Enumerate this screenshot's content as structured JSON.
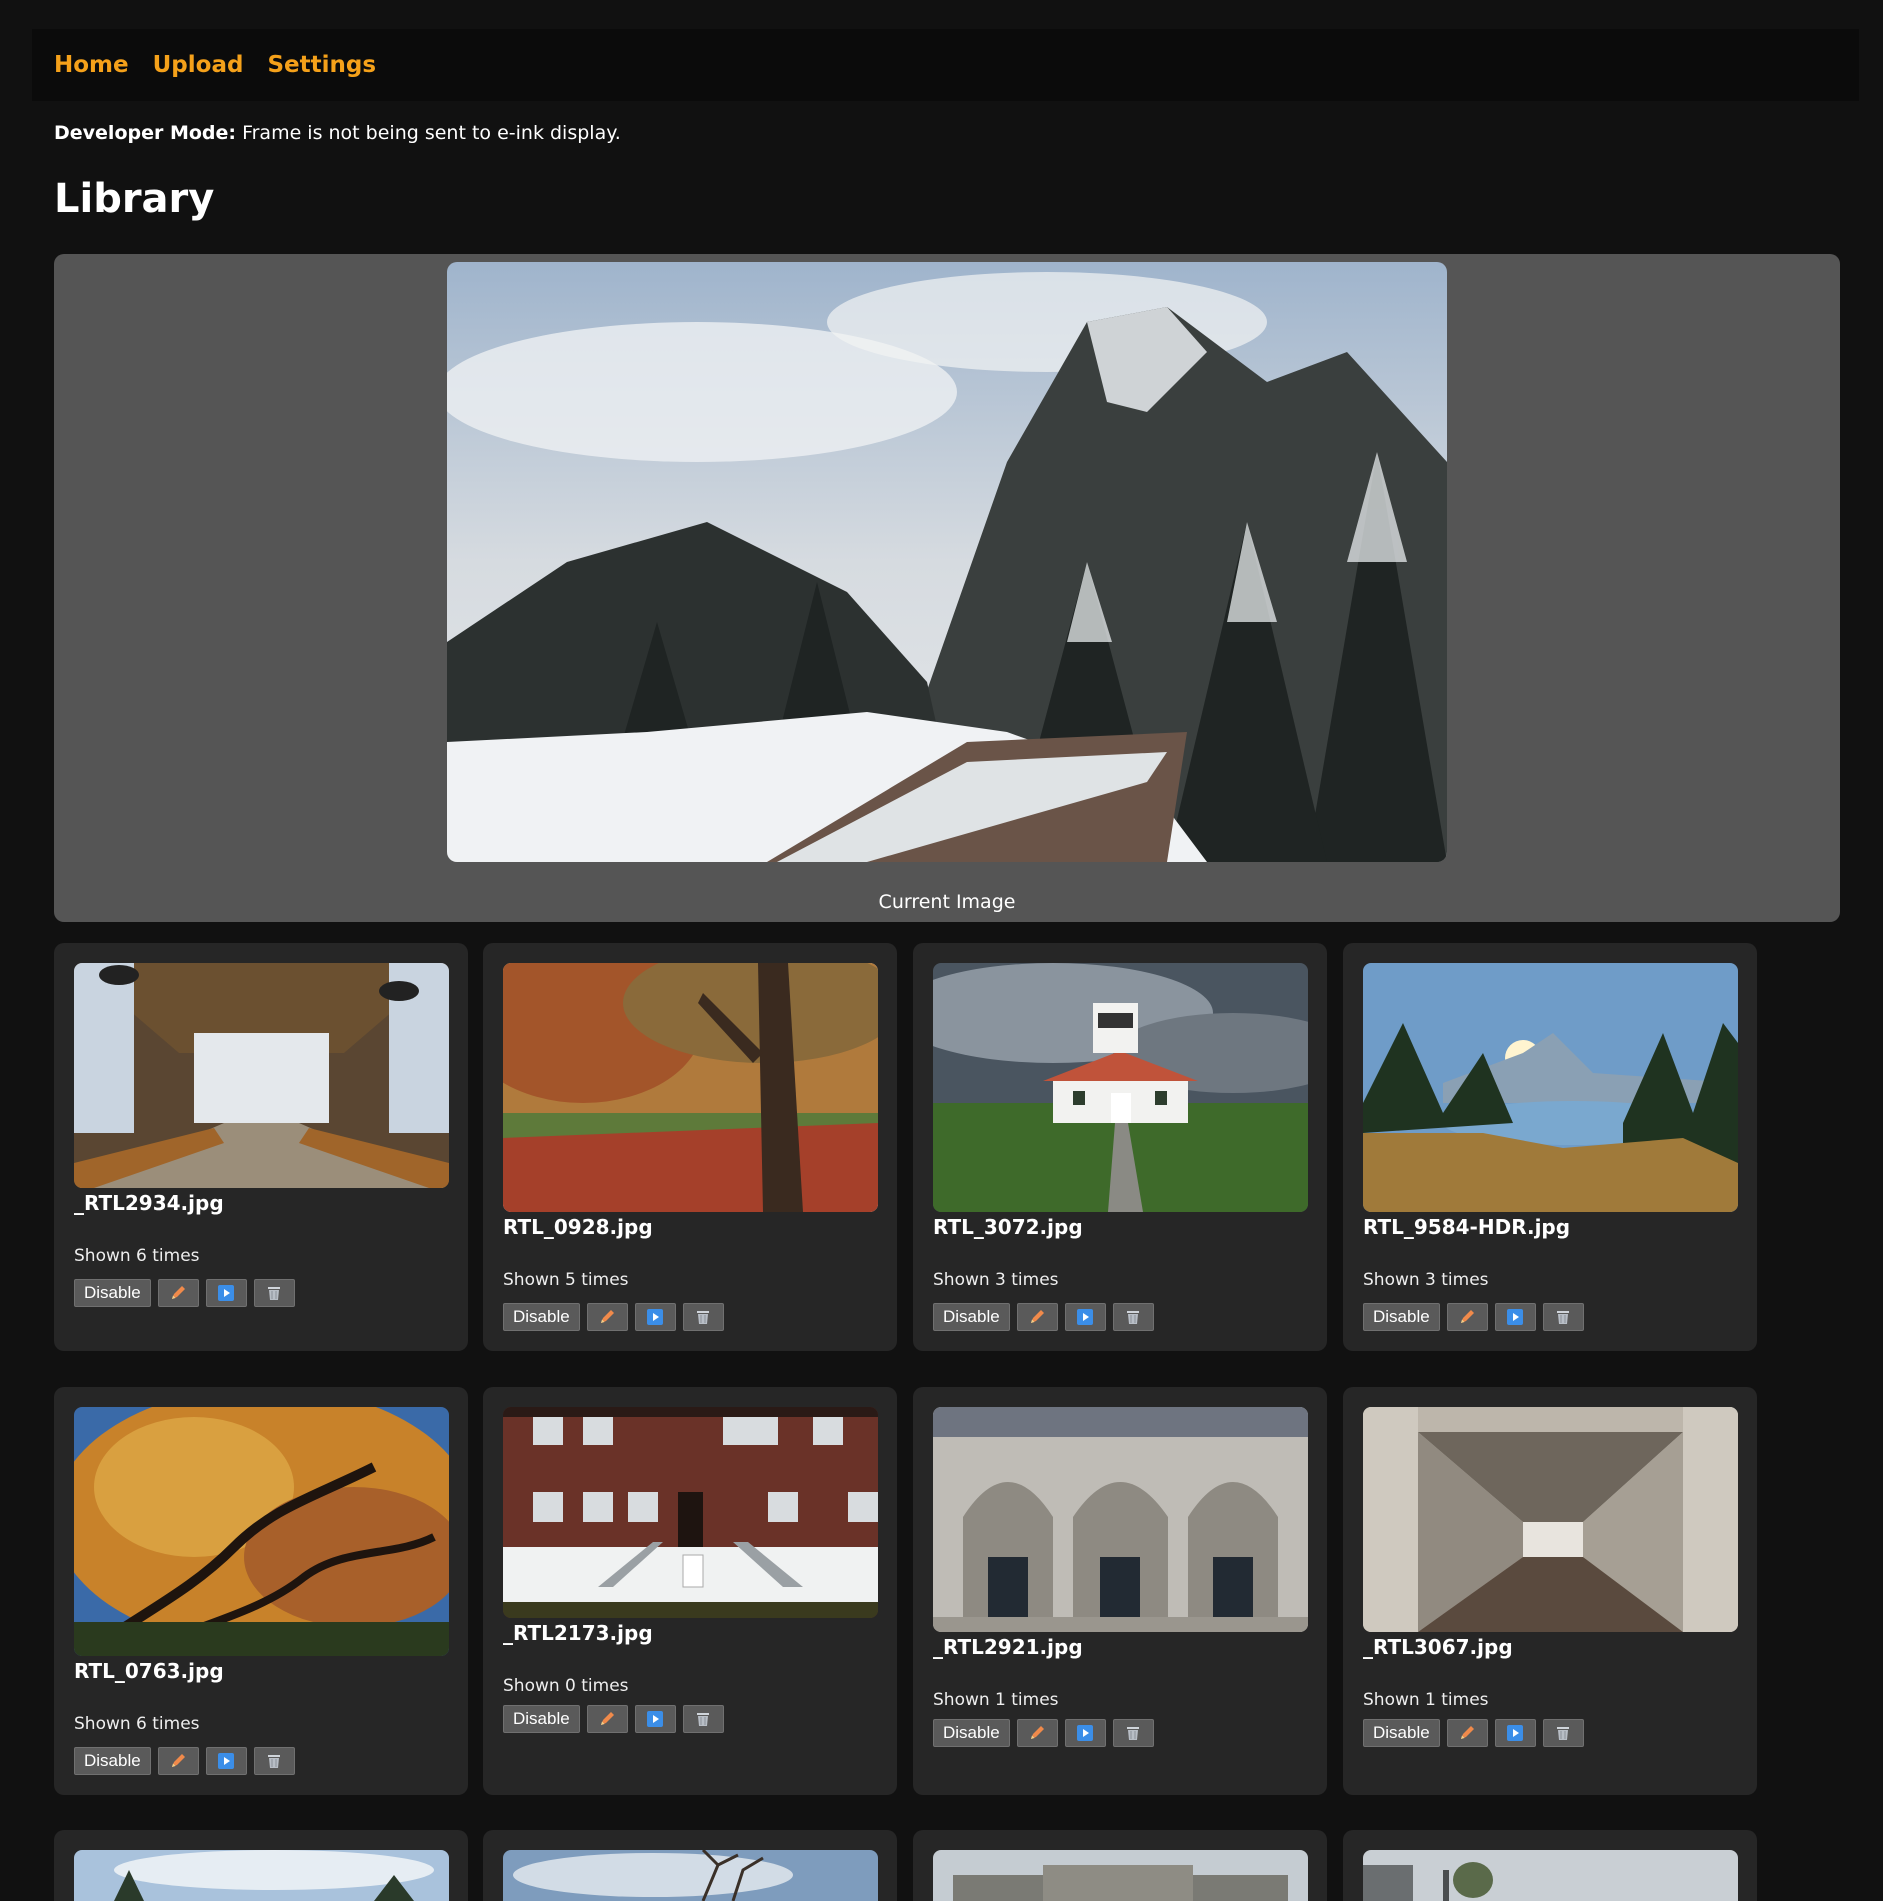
{
  "nav": {
    "home": "Home",
    "upload": "Upload",
    "settings": "Settings"
  },
  "dev_notice": {
    "label": "Developer Mode:",
    "text": "Frame is not being sent to e-ink display."
  },
  "page_title": "Library",
  "current": {
    "caption": "Current Image"
  },
  "buttons": {
    "disable": "Disable"
  },
  "icons": {
    "edit": "pencil-icon",
    "play": "play-icon",
    "delete": "trash-icon"
  },
  "colors": {
    "accent": "#f5a11a",
    "background": "#111111",
    "card": "#262626",
    "panel": "#555555"
  },
  "cards": [
    {
      "filename": "_RTL2934.jpg",
      "shown": "Shown 6 times"
    },
    {
      "filename": "RTL_0928.jpg",
      "shown": "Shown 5 times"
    },
    {
      "filename": "RTL_3072.jpg",
      "shown": "Shown 3 times"
    },
    {
      "filename": "RTL_9584-HDR.jpg",
      "shown": "Shown 3 times"
    },
    {
      "filename": "RTL_0763.jpg",
      "shown": "Shown 6 times"
    },
    {
      "filename": "_RTL2173.jpg",
      "shown": "Shown 0 times"
    },
    {
      "filename": "_RTL2921.jpg",
      "shown": "Shown 1 times"
    },
    {
      "filename": "_RTL3067.jpg",
      "shown": "Shown 1 times"
    }
  ]
}
